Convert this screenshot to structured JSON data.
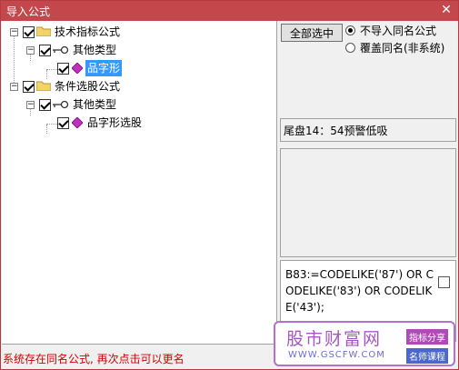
{
  "window": {
    "title": "导入公式",
    "close_glyph": "✕"
  },
  "tree": {
    "root1": {
      "label": "技术指标公式",
      "expander": "−"
    },
    "root1_child": {
      "label": "其他类型",
      "expander": "−"
    },
    "root1_leaf": {
      "label": "品字形"
    },
    "root2": {
      "label": "条件选股公式",
      "expander": "−"
    },
    "root2_child": {
      "label": "其他类型",
      "expander": "−"
    },
    "root2_leaf": {
      "label": "品字形选股"
    }
  },
  "options": {
    "select_all_label": "全部选中",
    "radio_skip_label": "不导入同名公式",
    "radio_overwrite_label": "覆盖同名(非系统)"
  },
  "info": {
    "text": "尾盘14：54预警低吸"
  },
  "code": {
    "text": "B83:=CODELIKE('87') OR CODELIKE('83') OR CODELIKE('43');"
  },
  "status": {
    "text": "系统存在同名公式, 再次点击可以更名"
  },
  "watermark": {
    "title": "股市财富网",
    "url": "WWW.GSCFW.COM",
    "tag1": "指标分享",
    "tag2": "名师课程"
  },
  "colors": {
    "titlebar": "#c4474c",
    "selection": "#3399ff",
    "status_text": "#d00000",
    "folder": "#f2d36b"
  }
}
